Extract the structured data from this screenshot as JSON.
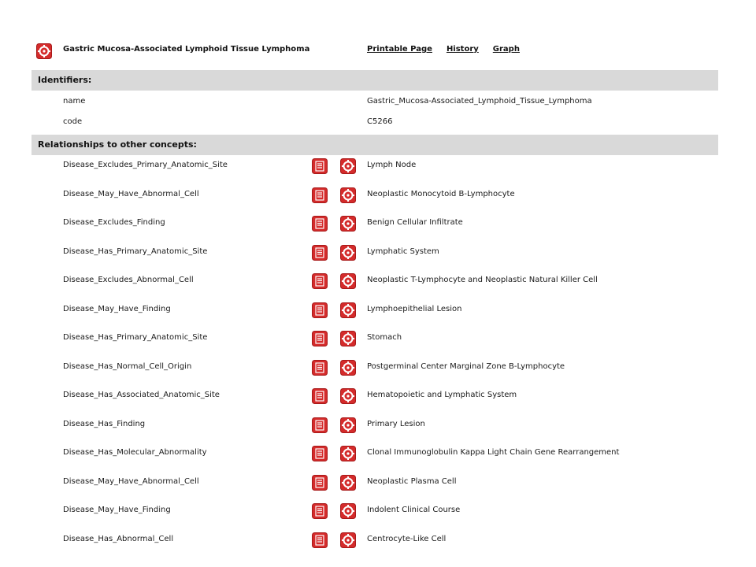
{
  "concept": {
    "title": "Gastric Mucosa-Associated Lymphoid Tissue Lymphoma"
  },
  "links": {
    "printable": "Printable Page",
    "history": "History",
    "graph": "Graph"
  },
  "colors": {
    "icon_red": "#d42b2b",
    "section_bg": "#d9d9d9"
  },
  "icons": {
    "concept": "concept-target-icon",
    "detail": "document-list-icon"
  },
  "identifiers": {
    "heading": "Identifiers:",
    "rows": [
      {
        "key": "name",
        "value": "Gastric_Mucosa-Associated_Lymphoid_Tissue_Lymphoma"
      },
      {
        "key": "code",
        "value": "C5266"
      }
    ]
  },
  "relationships": {
    "heading": "Relationships to other concepts:",
    "rows": [
      {
        "rel": "Disease_Excludes_Primary_Anatomic_Site",
        "value": "Lymph Node"
      },
      {
        "rel": "Disease_May_Have_Abnormal_Cell",
        "value": "Neoplastic Monocytoid B-Lymphocyte"
      },
      {
        "rel": "Disease_Excludes_Finding",
        "value": "Benign Cellular Infiltrate"
      },
      {
        "rel": "Disease_Has_Primary_Anatomic_Site",
        "value": "Lymphatic System"
      },
      {
        "rel": "Disease_Excludes_Abnormal_Cell",
        "value": "Neoplastic T-Lymphocyte and Neoplastic Natural Killer Cell"
      },
      {
        "rel": "Disease_May_Have_Finding",
        "value": "Lymphoepithelial Lesion"
      },
      {
        "rel": "Disease_Has_Primary_Anatomic_Site",
        "value": "Stomach"
      },
      {
        "rel": "Disease_Has_Normal_Cell_Origin",
        "value": "Postgerminal Center Marginal Zone B-Lymphocyte"
      },
      {
        "rel": "Disease_Has_Associated_Anatomic_Site",
        "value": "Hematopoietic and Lymphatic System"
      },
      {
        "rel": "Disease_Has_Finding",
        "value": "Primary Lesion"
      },
      {
        "rel": "Disease_Has_Molecular_Abnormality",
        "value": "Clonal Immunoglobulin Kappa Light Chain Gene Rearrangement"
      },
      {
        "rel": "Disease_May_Have_Abnormal_Cell",
        "value": "Neoplastic Plasma Cell"
      },
      {
        "rel": "Disease_May_Have_Finding",
        "value": "Indolent Clinical Course"
      },
      {
        "rel": "Disease_Has_Abnormal_Cell",
        "value": "Centrocyte-Like Cell"
      }
    ]
  }
}
